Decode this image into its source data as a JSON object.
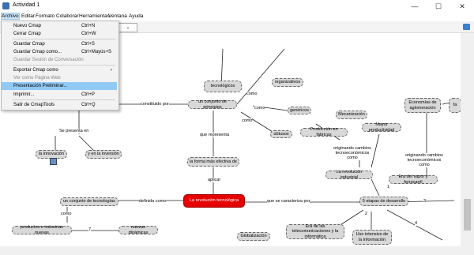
{
  "window": {
    "title": "Actividad 1",
    "minimize": "—",
    "maximize": "☐",
    "close": "✕"
  },
  "menu": [
    "Archivo",
    "Editar",
    "Formato",
    "Colaborar",
    "Herramientas",
    "Ventana",
    "Ayuda"
  ],
  "toolbar": {
    "combo_icon": "⌄"
  },
  "file_menu": [
    {
      "label": "Nuevo Cmap",
      "shortcut": "Ctrl+N"
    },
    {
      "label": "Cerrar Cmap",
      "shortcut": "Ctrl+W"
    },
    {
      "label": "Guardar Cmap",
      "shortcut": "Ctrl+S"
    },
    {
      "label": "Guardar Cmap como...",
      "shortcut": "Ctrl+Mayús+S"
    },
    {
      "label": "Guardar Sesión de Conversación",
      "shortcut": ""
    },
    {
      "label": "Exportar Cmap como",
      "shortcut": "›"
    },
    {
      "label": "Ver como Página Web",
      "shortcut": ""
    },
    {
      "label": "Presentación Preliminar...",
      "shortcut": ""
    },
    {
      "label": "Imprimir...",
      "shortcut": "Ctrl+P"
    },
    {
      "label": "Salir de CmapTools",
      "shortcut": "Ctrl+Q"
    }
  ],
  "concepts": {
    "tecnologicos": "tecnológicos",
    "organizativos": "organizativos",
    "conjunto_principios": "un conjunto de principios",
    "genericos": "genéricos",
    "obtusos": "obtusos",
    "innovacion": "la innovación",
    "inversion": "y en la inversión",
    "forma_efectiva": "la forma más efectiva de",
    "revolucion_tecnologica": "La revolución tecnológica",
    "conjunto_tecnologias": "un conjunto de tecnologías",
    "productos_industrias": "productos e industrias nuevas",
    "nuevas_dinamicas": "nuevas dinámicas",
    "mecanizacion": "Mecanización",
    "produccion_fabricas": "Producción en fábricas",
    "mayor_productividad": "Mayor productividad",
    "revolucion_industrial": "La revolución industrial",
    "era_vapor": "Era del vapor y ferrocarril",
    "economias": "Economías de aglomeración",
    "cinco_etapas": "5 etapas de desarrollo",
    "globalizacion": "Globalización",
    "era_telecom": "Era de las telecomunicaciones y la informática",
    "uso_intensivo": "Uso intensivo de la información",
    "fa": "fa"
  },
  "links": {
    "constituido_por": "constituido por",
    "como1": "como",
    "como2": "como",
    "como3": "como",
    "como4": "como",
    "se_presenta_en": "Se presenta en",
    "que_representa": "que representa",
    "aplicar": "aplicar",
    "definida_como": "definida como",
    "que_caracteriza": "que se caracteriza por",
    "originando1": "originando cambios tecnoeconómicos como",
    "originando2": "originando cambios tecnoeconómicos como",
    "n1": "1",
    "n2": "2",
    "n3": "3",
    "n4": "4",
    "n7": "7"
  }
}
